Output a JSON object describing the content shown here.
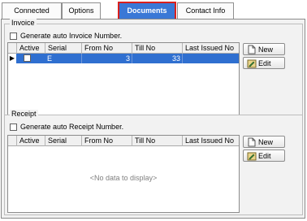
{
  "tabs": [
    {
      "label": "Connected Markets",
      "active": false
    },
    {
      "label": "Options",
      "active": false
    },
    {
      "label": "Documents",
      "active": true
    },
    {
      "label": "Contact Info",
      "active": false
    }
  ],
  "invoice": {
    "title": "Invoice",
    "auto_label": "Generate auto Invoice Number.",
    "auto_checked": false,
    "columns": [
      "Active",
      "Serial",
      "From No",
      "Till No",
      "Last Issued No"
    ],
    "rows": [
      {
        "active": false,
        "serial": "E",
        "from_no": "3",
        "till_no": "33",
        "last_issued_no": "",
        "selected": true
      }
    ],
    "new_label": "New",
    "edit_label": "Edit"
  },
  "receipt": {
    "title": "Receipt",
    "auto_label": "Generate auto Receipt Number.",
    "auto_checked": false,
    "columns": [
      "Active",
      "Serial",
      "From No",
      "Till No",
      "Last Issued No"
    ],
    "rows": [],
    "empty_text": "<No data to display>",
    "new_label": "New",
    "edit_label": "Edit"
  },
  "colors": {
    "active_tab": "#3a78d6",
    "active_tab_border": "#d9201d",
    "selection": "#2f6fd0"
  }
}
